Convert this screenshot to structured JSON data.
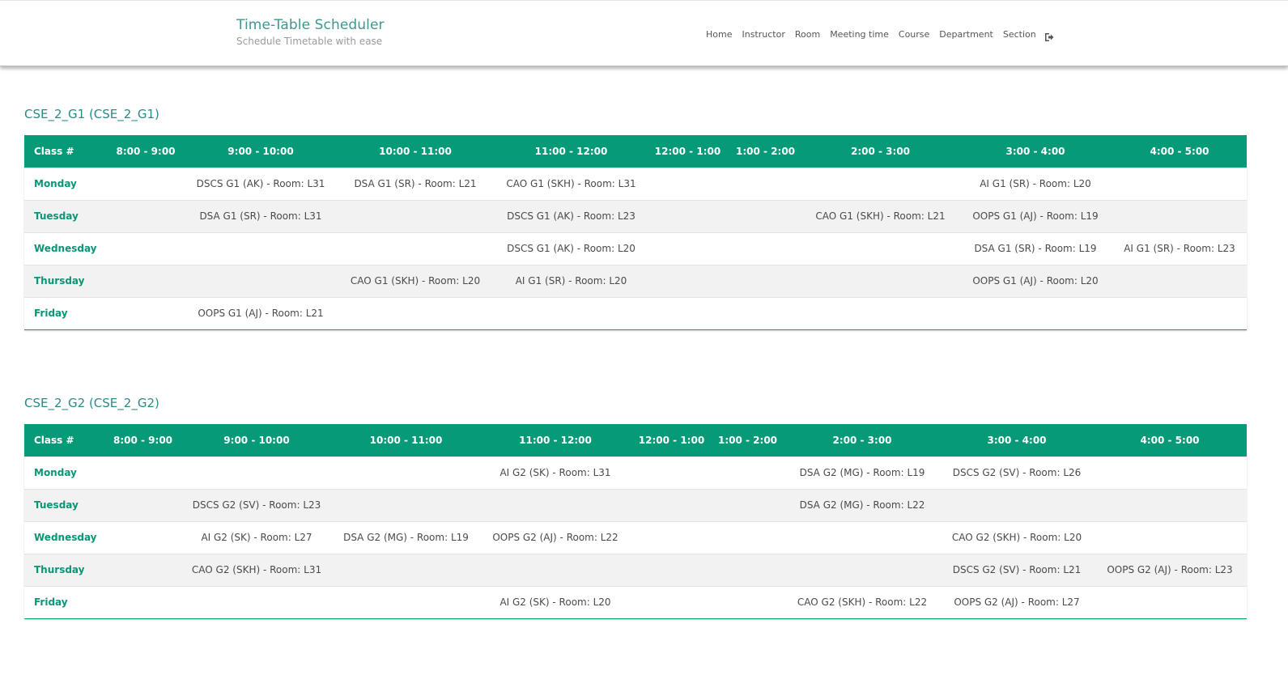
{
  "app": {
    "title": "Time-Table Scheduler",
    "subtitle": "Schedule Timetable with ease"
  },
  "nav": {
    "items": [
      "Home",
      "Instructor",
      "Room",
      "Meeting time",
      "Course",
      "Department",
      "Section"
    ],
    "logout_icon": "sign-out-icon"
  },
  "colors": {
    "brand": "#3f9690",
    "table_header": "#079a78",
    "day_label": "#0a9577"
  },
  "tables": [
    {
      "title": "CSE_2_G1 (CSE_2_G1)",
      "headers": [
        "Class #",
        "8:00 - 9:00",
        "9:00 - 10:00",
        "10:00 - 11:00",
        "11:00 - 12:00",
        "12:00 - 1:00",
        "1:00 - 2:00",
        "2:00 - 3:00",
        "3:00 - 4:00",
        "4:00 - 5:00"
      ],
      "rows": [
        {
          "day": "Monday",
          "cells": [
            "",
            "DSCS G1 (AK) - Room: L31",
            "DSA G1 (SR) - Room: L21",
            "CAO G1 (SKH) - Room: L31",
            "",
            "",
            "",
            "AI G1 (SR) - Room: L20",
            ""
          ]
        },
        {
          "day": "Tuesday",
          "cells": [
            "",
            "DSA G1 (SR) - Room: L31",
            "",
            "DSCS G1 (AK) - Room: L23",
            "",
            "",
            "CAO G1 (SKH) - Room: L21",
            "OOPS G1 (AJ) - Room: L19",
            ""
          ]
        },
        {
          "day": "Wednesday",
          "cells": [
            "",
            "",
            "",
            "DSCS G1 (AK) - Room: L20",
            "",
            "",
            "",
            "DSA G1 (SR) - Room: L19",
            "AI G1 (SR) - Room: L23"
          ]
        },
        {
          "day": "Thursday",
          "cells": [
            "",
            "",
            "CAO G1 (SKH) - Room: L20",
            "AI G1 (SR) - Room: L20",
            "",
            "",
            "",
            "OOPS G1 (AJ) - Room: L20",
            ""
          ]
        },
        {
          "day": "Friday",
          "cells": [
            "",
            "OOPS G1 (AJ) - Room: L21",
            "",
            "",
            "",
            "",
            "",
            "",
            ""
          ]
        }
      ]
    },
    {
      "title": "CSE_2_G2 (CSE_2_G2)",
      "headers": [
        "Class #",
        "8:00 - 9:00",
        "9:00 - 10:00",
        "10:00 - 11:00",
        "11:00 - 12:00",
        "12:00 - 1:00",
        "1:00 - 2:00",
        "2:00 - 3:00",
        "3:00 - 4:00",
        "4:00 - 5:00"
      ],
      "rows": [
        {
          "day": "Monday",
          "cells": [
            "",
            "",
            "",
            "AI G2 (SK) - Room: L31",
            "",
            "",
            "DSA G2 (MG) - Room: L19",
            "DSCS G2 (SV) - Room: L26",
            ""
          ]
        },
        {
          "day": "Tuesday",
          "cells": [
            "",
            "DSCS G2 (SV) - Room: L23",
            "",
            "",
            "",
            "",
            "DSA G2 (MG) - Room: L22",
            "",
            ""
          ]
        },
        {
          "day": "Wednesday",
          "cells": [
            "",
            "AI G2 (SK) - Room: L27",
            "DSA G2 (MG) - Room: L19",
            "OOPS G2 (AJ) - Room: L22",
            "",
            "",
            "",
            "CAO G2 (SKH) - Room: L20",
            ""
          ]
        },
        {
          "day": "Thursday",
          "cells": [
            "",
            "CAO G2 (SKH) - Room: L31",
            "",
            "",
            "",
            "",
            "",
            "DSCS G2 (SV) - Room: L21",
            "OOPS G2 (AJ) - Room: L23"
          ]
        },
        {
          "day": "Friday",
          "cells": [
            "",
            "",
            "",
            "AI G2 (SK) - Room: L20",
            "",
            "",
            "CAO G2 (SKH) - Room: L22",
            "OOPS G2 (AJ) - Room: L27",
            ""
          ]
        }
      ]
    }
  ]
}
